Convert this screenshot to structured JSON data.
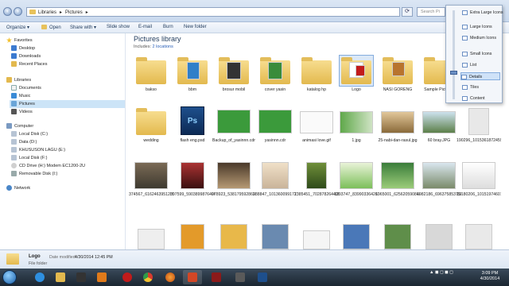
{
  "address": {
    "crumbs": [
      "Libraries",
      "▸",
      "Pictures",
      "▸"
    ],
    "search_placeholder": "Search Pi"
  },
  "toolbar": {
    "organize": "Organize ▾",
    "open": "Open",
    "share": "Share with ▾",
    "slideshow": "Slide show",
    "email": "E-mail",
    "burn": "Burn",
    "new_folder": "New folder"
  },
  "nav": {
    "favorites": "Favorites",
    "desktop": "Desktop",
    "downloads": "Downloads",
    "recent": "Recent Places",
    "libraries": "Libraries",
    "documents": "Documents",
    "music": "Music",
    "pictures": "Pictures",
    "videos": "Videos",
    "computer": "Computer",
    "drive_c": "Local Disk (C:)",
    "drive_d": "Data (D:)",
    "drive_e": "KHUSUSON LAGU (E:)",
    "drive_f": "Local Disk (F:)",
    "drive_g": "CD Drive (H:) Modem EC1200-2U",
    "drive_r": "Removable Disk (I:)",
    "network": "Network"
  },
  "library": {
    "title": "Pictures library",
    "includes": "Includes:",
    "locations": "2 locations"
  },
  "files": {
    "r1": [
      "bakso",
      "bbm",
      "brosur mobil",
      "cover yasin",
      "katalog hp",
      "Logo",
      "NASI GORENG",
      "Sample Pictures"
    ],
    "r2": [
      "wedding",
      "flash eng.psd",
      "Backup_of_yasinnn.cdr",
      "yasinnn.cdr",
      "animasi love.gif",
      "1.jpg",
      "25-nabi-dan-rasul.jpg",
      "60 bray.JPG",
      "190296_101536187245935539485188_n.jpg"
    ],
    "r3": [
      "374567_616246395120523_1818455710191312974_n.jpg",
      "397599_5903899876406591313272337_n.jpg",
      "978923_53817959286212337097477930629484_n.jpg",
      "988847_10136009917211511534458322_n.jpg",
      "1385451_70287826449588_1185585010_n.jpg",
      "1393747_83990336426748_7094993040057807733_n.jpg",
      "1965001_62562059084002534540531_n.jpg",
      "1982186_69637585375676_7832842041420799941_n.jpg",
      "10180206_10151974601321636_8716790067630821820_n.jpg"
    ],
    "r4": [
      "",
      "",
      "",
      "",
      "",
      "",
      "",
      "",
      ""
    ]
  },
  "viewmenu": {
    "extra_large": "Extra Large Icons",
    "large": "Large Icons",
    "medium": "Medium Icons",
    "small": "Small Icons",
    "list": "List",
    "details": "Details",
    "tiles": "Tiles",
    "content": "Content"
  },
  "details": {
    "name": "Logo",
    "type": "File folder",
    "date_label": "Date modified:",
    "date": "4/30/2014 12:45 PM"
  },
  "taskbar": {
    "time": "3:09 PM",
    "date": "4/30/2014"
  }
}
